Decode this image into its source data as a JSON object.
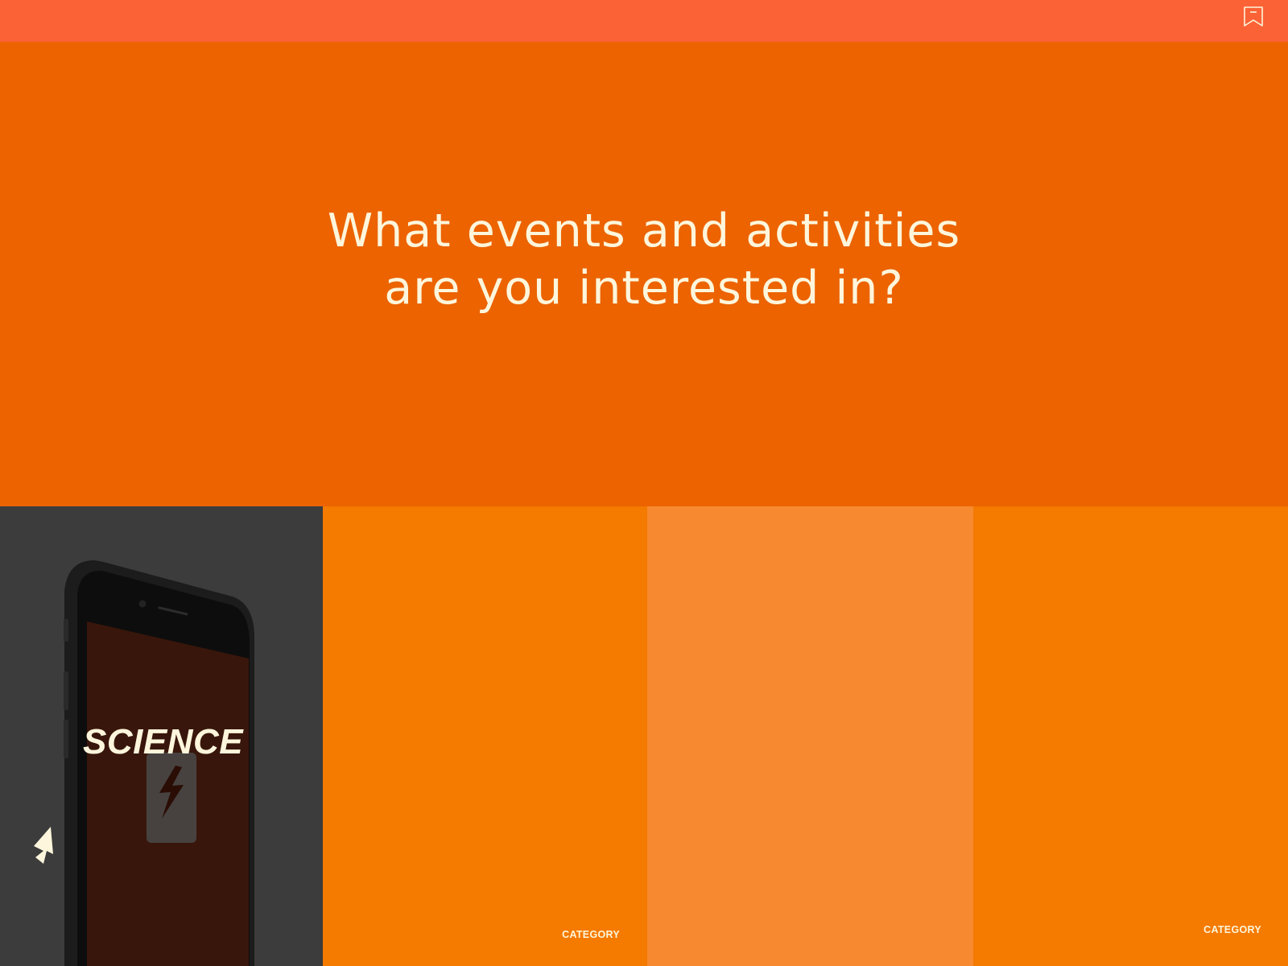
{
  "header": {
    "bookmark_icon": "bookmark-icon"
  },
  "hero": {
    "title": "What events and activities\nare you interested in?"
  },
  "tiles": [
    {
      "label": "SCIENCE",
      "style": "image-dark",
      "icon": "lightning-bolt-icon"
    },
    {
      "label": "CATEGORY",
      "style": "orange"
    },
    {
      "label": "",
      "style": "light-orange"
    },
    {
      "label": "CATEGORY",
      "style": "orange"
    }
  ],
  "colors": {
    "topbar": "#fb6236",
    "hero": "#ec6300",
    "tile_orange": "#f57a00",
    "tile_light_orange": "#f78a30",
    "tile_dark": "#3c3c3c",
    "text": "#fdf6dc"
  }
}
